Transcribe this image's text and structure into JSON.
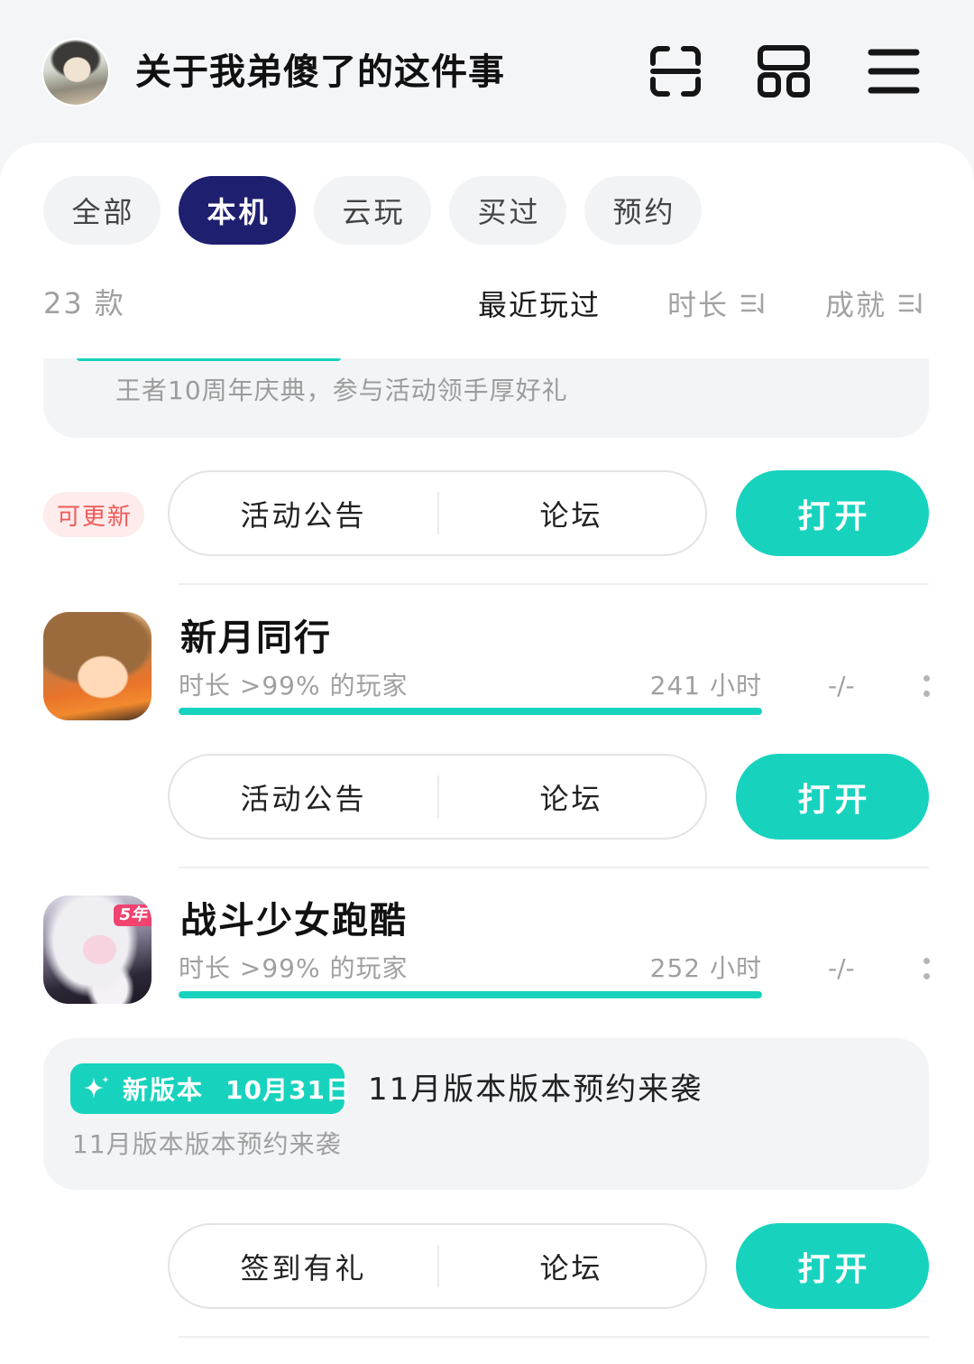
{
  "colors": {
    "accent": "#17d3bd",
    "tab_active": "#1f1f70",
    "update_badge_bg": "#fdeceb",
    "update_badge_text": "#ef5a5a"
  },
  "header": {
    "title": "关于我弟傻了的这件事",
    "icons": [
      "scan-icon",
      "grid-icon",
      "menu-icon"
    ]
  },
  "tabs": [
    {
      "label": "全部",
      "active": false
    },
    {
      "label": "本机",
      "active": true
    },
    {
      "label": "云玩",
      "active": false
    },
    {
      "label": "买过",
      "active": false
    },
    {
      "label": "预约",
      "active": false
    }
  ],
  "list_header": {
    "count": "23 款",
    "sort_options": [
      {
        "label": "最近玩过",
        "active": true
      },
      {
        "label": "时长",
        "active": false,
        "icon": "sort-icon"
      },
      {
        "label": "成就",
        "active": false,
        "icon": "sort-icon"
      }
    ]
  },
  "items": [
    {
      "notice": "王者10周年庆典，参与活动领手厚好礼",
      "update_badge": "可更新",
      "actions": [
        "活动公告",
        "论坛"
      ],
      "open_label": "打开"
    },
    {
      "icon": "game-icon",
      "title": "新月同行",
      "stat_label": "时长 >99% 的玩家",
      "hours": "241 小时",
      "progress": 1,
      "achievement": "-/-",
      "actions": [
        "活动公告",
        "论坛"
      ],
      "open_label": "打开"
    },
    {
      "icon": "game-icon",
      "icon_badge": "5年",
      "title": "战斗少女跑酷",
      "stat_label": "时长 >99% 的玩家",
      "hours": "252 小时",
      "progress": 1,
      "achievement": "-/-",
      "news": {
        "badge": "新版本",
        "date": "10月31日",
        "title": "11月版本版本预约来袭",
        "subtitle": "11月版本版本预约来袭"
      },
      "actions": [
        "签到有礼",
        "论坛"
      ],
      "open_label": "打开"
    }
  ]
}
